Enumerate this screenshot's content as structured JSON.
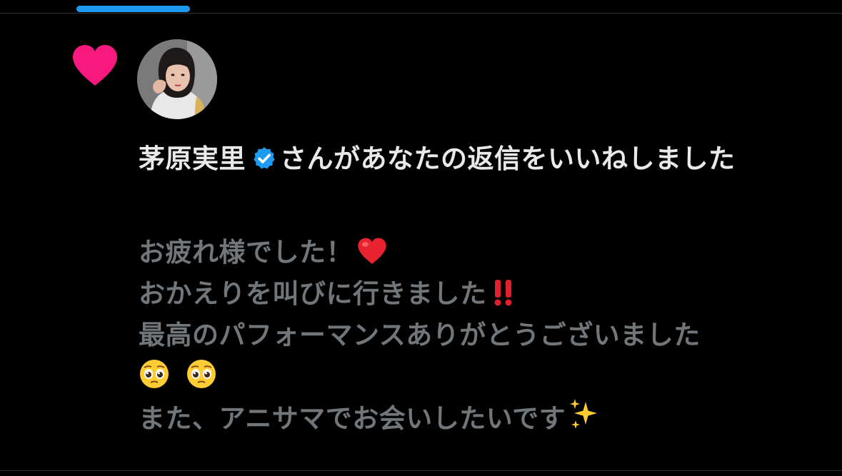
{
  "colors": {
    "background": "#000000",
    "tab_accent": "#1d9bf0",
    "like_heart": "#f91880",
    "verified_badge": "#1d9bf0",
    "primary_text": "#e7e9ea",
    "secondary_text": "#71767b"
  },
  "notification": {
    "type_icon": "heart-icon",
    "user": {
      "name": "茅原実里",
      "verified": true,
      "avatar": "avatar-photo"
    },
    "action_text": "さんがあなたの返信をいいねしました",
    "reply": {
      "lines": [
        {
          "text": "お疲れ様でした！",
          "emoji": "red-heart"
        },
        {
          "text": "おかえりを叫びに行きました",
          "emoji": "double-exclamation"
        },
        {
          "text": "最高のパフォーマンスありがとうございました",
          "emoji": ""
        },
        {
          "text": "",
          "emoji": "pleading-face pleading-face"
        },
        {
          "text": "また、アニサマでお会いしたいです",
          "emoji": "sparkles"
        }
      ]
    }
  }
}
